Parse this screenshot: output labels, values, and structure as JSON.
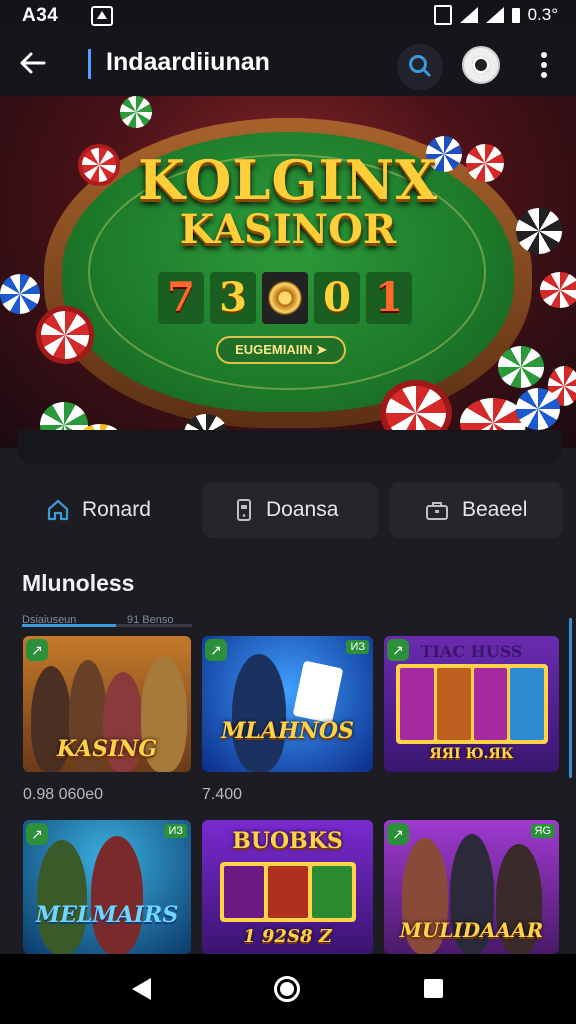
{
  "status_bar": {
    "time": "A34",
    "right_text": "0.3°"
  },
  "app_bar": {
    "title": "Indaardiiunan"
  },
  "hero": {
    "logo_line1": "KOLGINX",
    "logo_line2": "KASINOR",
    "digits": [
      "7",
      "3",
      "",
      "0",
      "1"
    ],
    "button_label": "EUGEMIAIIN ➤"
  },
  "quick_actions": [
    {
      "label": "Ronard",
      "icon": "home-icon"
    },
    {
      "label": "Doansa",
      "icon": "phone-icon"
    },
    {
      "label": "Beaeel",
      "icon": "briefcase-icon"
    }
  ],
  "section": {
    "title": "Mlunoless",
    "progress_left": "Dsiaiuseun",
    "progress_right": "91 Benso",
    "progress_value": 0.55
  },
  "games": [
    {
      "title": "KASING",
      "caption": "0.98 060e0",
      "badge": ""
    },
    {
      "title": "MLAHNOS",
      "caption": "7.400",
      "badge": "ИЗ"
    },
    {
      "title": "TIAC HUSS",
      "caption": "",
      "badge": "",
      "subtitle": "ЯЯI Ю.ЯК"
    },
    {
      "title": "MELMAIRS",
      "caption": "",
      "badge": "ИЗ"
    },
    {
      "title": "BUOBKS",
      "caption": "",
      "badge": "",
      "subtitle": "1 92S8 Z"
    },
    {
      "title": "MULIDAAAR",
      "caption": "",
      "badge": "ЯG"
    }
  ],
  "colors": {
    "accent": "#3b9bd6",
    "gold": "#ffd24a",
    "felt": "#1d7a2a",
    "background": "#1d1c22"
  }
}
